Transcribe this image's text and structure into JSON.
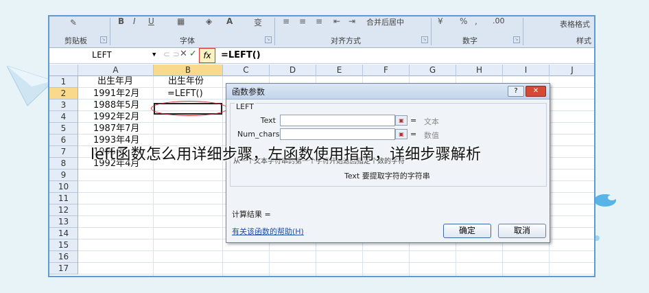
{
  "ribbon": {
    "groups": [
      "剪贴板",
      "字体",
      "对齐方式",
      "数字",
      "样式"
    ],
    "font_buttons": [
      "B",
      "I",
      "U"
    ],
    "wrap_label": "合并后居中",
    "percent": "%",
    "comma": ",",
    "decimal": ".00",
    "table_format": "表格格式"
  },
  "formula_bar": {
    "name_box": "LEFT",
    "cancel": "✕",
    "enter": "✓",
    "fx": "fx",
    "formula": "=LEFT()"
  },
  "columns": [
    "A",
    "B",
    "C",
    "D",
    "E",
    "F",
    "G",
    "H",
    "I",
    "J"
  ],
  "rows": [
    "1",
    "2",
    "3",
    "4",
    "5",
    "6",
    "7",
    "8",
    "9",
    "10",
    "11",
    "12",
    "13",
    "14",
    "15",
    "16",
    "17"
  ],
  "cells": {
    "a1": "出生年月",
    "b1": "出生年份",
    "a2": "1991年2月",
    "b2": "=LEFT()",
    "a3": "1988年5月",
    "a4": "1992年2月",
    "a5": "1987年7月",
    "a6": "1993年4月",
    "a7": "1995年",
    "a8": "1992年4月"
  },
  "dialog": {
    "title": "函数参数",
    "help_button": "?",
    "close_button": "✕",
    "function_name": "LEFT",
    "arg1_label": "Text",
    "arg1_hint": "文本",
    "arg2_label": "Num_chars",
    "arg2_hint": "数值",
    "equals": "=",
    "description": "从一个文本字符串的第一个字符开始返回指定个数的字符",
    "arg_description": "Text  要提取字符的字符串",
    "result_label": "计算结果 =",
    "help_link": "有关该函数的帮助(H)",
    "ok_button": "确定",
    "cancel_button": "取消"
  },
  "caption": "left函数怎么用详细步骤，左函数使用指南，详细步骤解析",
  "colors": {
    "frame": "#5b9bd5",
    "selected_header": "#f9d98b",
    "highlight_red": "#d9262b"
  }
}
